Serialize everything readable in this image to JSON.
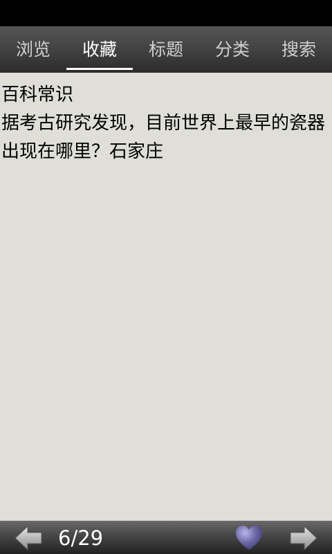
{
  "tabs": [
    {
      "label": "浏览",
      "active": false
    },
    {
      "label": "收藏",
      "active": true
    },
    {
      "label": "标题",
      "active": false
    },
    {
      "label": "分类",
      "active": false
    },
    {
      "label": "搜索",
      "active": false
    }
  ],
  "content": {
    "category": "百科常识",
    "body": "据考古研究发现，目前世界上最早的瓷器出现在哪里？石家庄"
  },
  "pager": {
    "page_text": "6/29"
  },
  "icons": {
    "prev": "arrow-left-icon",
    "favorite": "heart-icon",
    "next": "arrow-right-icon"
  },
  "colors": {
    "content_background": "#dfdfd8",
    "heart": "#6e6aa8"
  }
}
